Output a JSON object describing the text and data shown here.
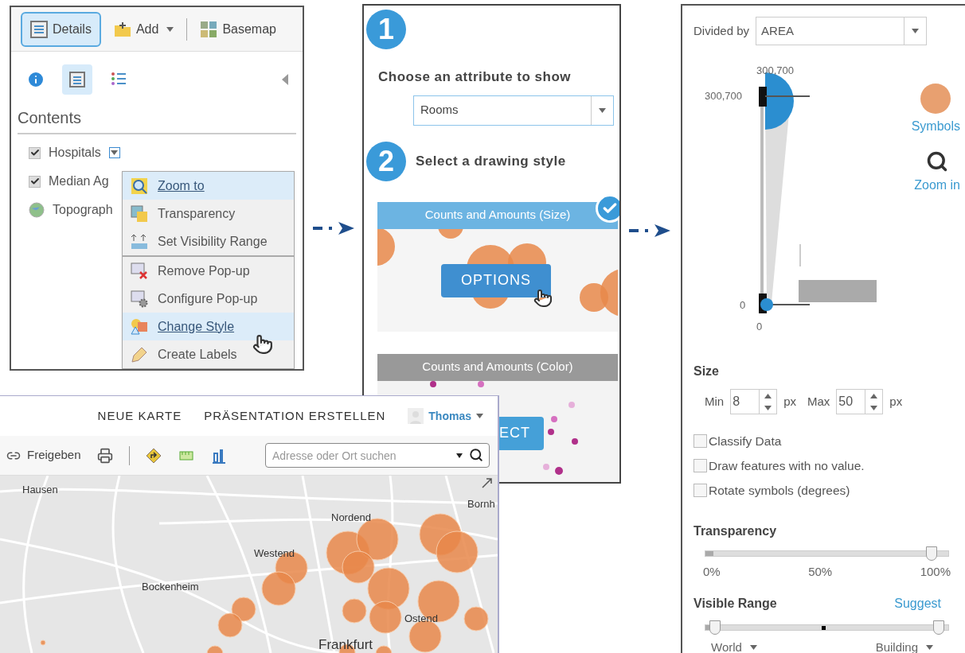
{
  "layers_panel": {
    "toolbar": [
      {
        "label": "Details",
        "kind": "details",
        "selected": true,
        "dropdown": false
      },
      {
        "label": "Add",
        "kind": "add",
        "selected": false,
        "dropdown": true
      },
      {
        "label": "Basemap",
        "kind": "basemap",
        "selected": false,
        "dropdown": false
      }
    ],
    "view_tabs": [
      {
        "kind": "info",
        "selected": false
      },
      {
        "kind": "contents",
        "selected": true
      },
      {
        "kind": "legend",
        "selected": false
      }
    ],
    "heading": "Contents",
    "layers": [
      {
        "name": "Hospitals",
        "kind": "checkbox",
        "checked": true,
        "menu_open": true
      },
      {
        "name": "Median Ag",
        "kind": "checkbox",
        "checked": true,
        "menu_open": false
      },
      {
        "name": "Topograph",
        "kind": "basemap",
        "menu_open": false
      }
    ],
    "menu_groups": [
      [
        {
          "label": "Zoom to",
          "kind": "zoom",
          "selected": true
        },
        {
          "label": "Transparency",
          "kind": "transparency",
          "selected": false
        },
        {
          "label": "Set Visibility Range",
          "kind": "visibility",
          "selected": false
        }
      ],
      [
        {
          "label": "Remove Pop-up",
          "kind": "remove-popup",
          "selected": false
        },
        {
          "label": "Configure Pop-up",
          "kind": "configure-popup",
          "selected": false
        },
        {
          "label": "Change Style",
          "kind": "style",
          "selected": true
        },
        {
          "label": "Create Labels",
          "kind": "labels",
          "selected": false
        }
      ]
    ]
  },
  "style_panel": {
    "steps": [
      {
        "number": "1",
        "title": "Choose an attribute to show"
      },
      {
        "number": "2",
        "title": "Select a drawing style"
      }
    ],
    "attribute_select": {
      "value": "Rooms"
    },
    "styles": [
      {
        "title": "Counts and Amounts (Size)",
        "kind": "size",
        "selected": true,
        "button": "OPTIONS"
      },
      {
        "title": "Counts and Amounts (Color)",
        "kind": "color",
        "selected": false,
        "button": "ECT"
      }
    ]
  },
  "options_panel": {
    "divided_by": {
      "label": "Divided by",
      "value": "AREA"
    },
    "histogram": {
      "top_value": "300,700",
      "max_label": "300,700",
      "min_label": "0",
      "bottom_value": "0"
    },
    "links": [
      {
        "label": "Symbols",
        "kind": "symbols"
      },
      {
        "label": "Zoom in",
        "kind": "zoom"
      }
    ],
    "size": {
      "heading": "Size",
      "fields": [
        {
          "label": "Min",
          "value": "8",
          "unit": "px"
        },
        {
          "label": "Max",
          "value": "50",
          "unit": "px"
        }
      ]
    },
    "checkboxes": [
      {
        "label": "Classify Data",
        "checked": false
      },
      {
        "label": "Draw features with no value.",
        "checked": false
      },
      {
        "label": "Rotate symbols (degrees)",
        "checked": false
      }
    ],
    "transparency": {
      "heading": "Transparency",
      "level": 0.93,
      "ticks": [
        "0%",
        "50%",
        "100%"
      ]
    },
    "visible_range": {
      "heading": "Visible Range",
      "action": "Suggest",
      "start": {
        "level": 0.04,
        "label": "World"
      },
      "end": {
        "level": 0.96,
        "label": "Building"
      }
    }
  },
  "map_window": {
    "nav": [
      "NEUE KARTE",
      "PRÄSENTATION ERSTELLEN"
    ],
    "user": "Thomas",
    "share": "Freigeben",
    "search": {
      "placeholder": "Adresse oder Ort suchen"
    },
    "places": [
      {
        "name": "Hausen"
      },
      {
        "name": "Bornh"
      },
      {
        "name": "Nordend"
      },
      {
        "name": "Westend"
      },
      {
        "name": "Bockenheim"
      },
      {
        "name": "Ostend"
      },
      {
        "name": "Frankfurt"
      }
    ]
  }
}
